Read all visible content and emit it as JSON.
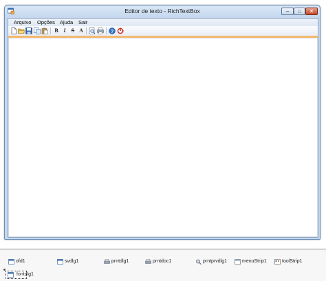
{
  "window": {
    "title": "Editor de texto  - RichTextBox",
    "controls": {
      "minimize": "–",
      "maximize": "□",
      "close": "✕"
    }
  },
  "menu": [
    {
      "label": "Arquivo"
    },
    {
      "label": "Opções"
    },
    {
      "label": "Ajuda"
    },
    {
      "label": "Sair"
    }
  ],
  "toolbar": {
    "icons": [
      "new-file-icon",
      "open-folder-icon",
      "save-icon",
      "copy-icon",
      "paste-icon",
      "bold-icon",
      "italic-icon",
      "strikeout-icon",
      "font-icon",
      "print-preview-icon",
      "print-icon",
      "help-icon",
      "exit-icon"
    ],
    "bold": "B",
    "italic": "I",
    "strike": "S",
    "font": "A"
  },
  "editor": {
    "text": ""
  },
  "tray": {
    "components": [
      {
        "label": "ofd1",
        "icon": "open-file-dialog-icon"
      },
      {
        "label": "svdlg1",
        "icon": "save-file-dialog-icon"
      },
      {
        "label": "prntdlg1",
        "icon": "print-dialog-icon"
      },
      {
        "label": "prntdoc1",
        "icon": "print-document-icon"
      },
      {
        "label": "prntprvdlg1",
        "icon": "print-preview-dialog-icon"
      },
      {
        "label": "menuStrip1",
        "icon": "menu-strip-icon"
      },
      {
        "label": "toolStrip1",
        "icon": "tool-strip-icon"
      },
      {
        "label": "fontdlg1",
        "icon": "font-dialog-icon"
      }
    ]
  },
  "colors": {
    "toolbar_accent": "#f4b86e",
    "title_gradient_top": "#dbe8f7",
    "close_button": "#c4462b"
  }
}
